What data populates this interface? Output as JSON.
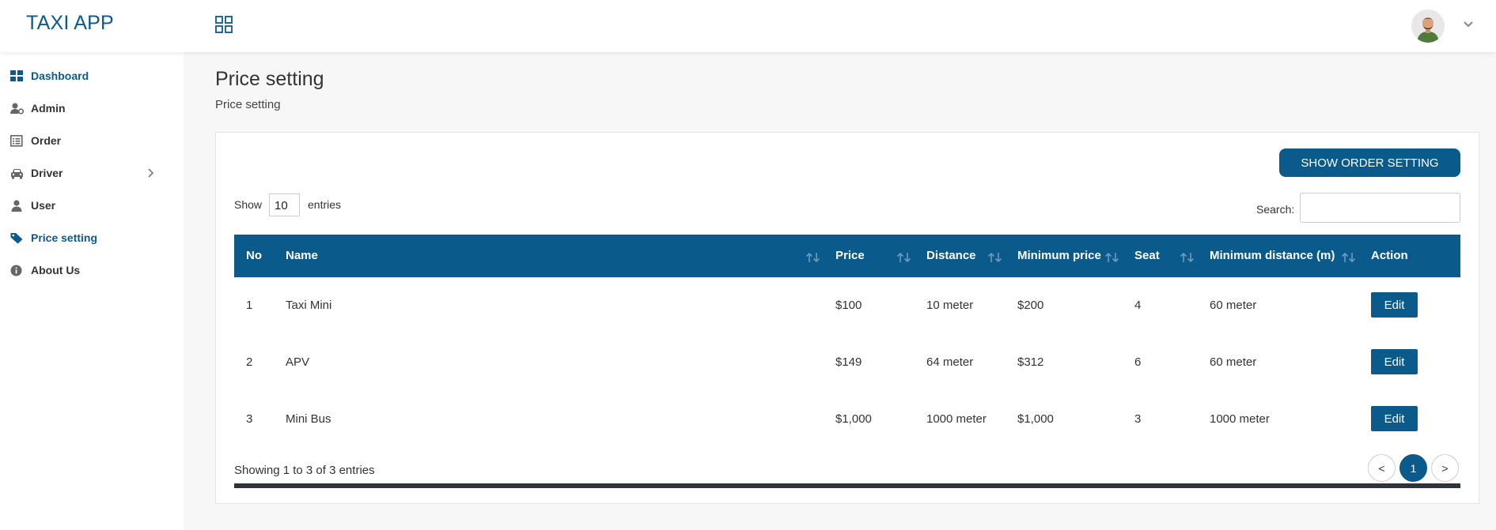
{
  "app": {
    "brand": "TAXI APP"
  },
  "header": {
    "apps_icon": "grid-icon",
    "avatar_icon": "user-avatar",
    "menu_icon": "chevron-down-icon"
  },
  "sidebar": {
    "items": [
      {
        "label": "Dashboard",
        "icon": "dashboard-icon"
      },
      {
        "label": "Admin",
        "icon": "admin-cog-icon"
      },
      {
        "label": "Order",
        "icon": "list-icon"
      },
      {
        "label": "Driver",
        "icon": "car-icon",
        "expandable": true
      },
      {
        "label": "User",
        "icon": "user-icon"
      },
      {
        "label": "Price setting",
        "icon": "tag-icon",
        "active": true
      },
      {
        "label": "About Us",
        "icon": "info-icon"
      }
    ]
  },
  "page": {
    "title": "Price setting",
    "subtitle": "Price setting"
  },
  "toolbar": {
    "show_order_label": "SHOW ORDER SETTING"
  },
  "table_controls": {
    "show_label": "Show",
    "entries_value": "10",
    "entries_label": "entries",
    "search_label": "Search:",
    "search_value": ""
  },
  "table": {
    "columns": [
      "No",
      "Name",
      "Price",
      "Distance",
      "Minimum price",
      "Seat",
      "Minimum distance  (m)",
      "Action"
    ],
    "rows": [
      [
        "1",
        "Taxi Mini",
        "$100",
        "10 meter",
        "$200",
        "4",
        "60 meter",
        "Edit"
      ],
      [
        "2",
        "APV",
        "$149",
        "64 meter",
        "$312",
        "6",
        "60 meter",
        "Edit"
      ],
      [
        "3",
        "Mini Bus",
        "$1,000",
        "1000 meter",
        "$1,000",
        "3",
        "1000 meter",
        "Edit"
      ]
    ]
  },
  "footer": {
    "info": "Showing 1 to 3 of 3 entries"
  },
  "pagination": {
    "prev": "<",
    "current": "1",
    "next": ">"
  },
  "colors": {
    "primary": "#0b5a8c",
    "background": "#f7f7f7",
    "sidebar_active": "#0b5a8c"
  }
}
